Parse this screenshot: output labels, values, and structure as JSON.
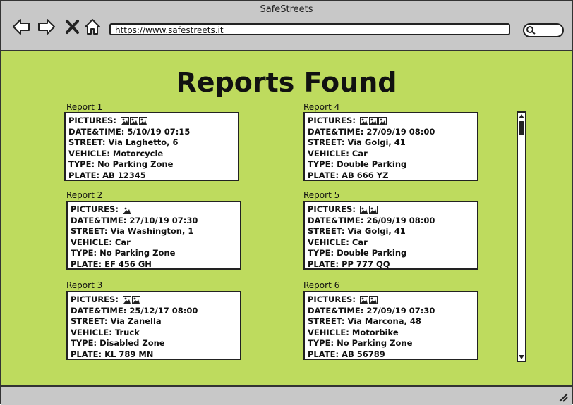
{
  "window": {
    "title": "SafeStreets"
  },
  "toolbar": {
    "url": "https://www.safestreets.it"
  },
  "page": {
    "heading": "Reports Found"
  },
  "field_labels": {
    "pictures": "PICTURES:",
    "datetime": "DATE&TIME:",
    "street": "STREET:",
    "vehicle": "VEHICLE:",
    "type": "TYPE:",
    "plate": "PLATE:"
  },
  "reports": [
    {
      "label": "Report 1",
      "picture_count": 3,
      "datetime": "5/10/19 07:15",
      "street": "Via Laghetto, 6",
      "vehicle": "Motorcycle",
      "type": "No Parking Zone",
      "plate": "AB 12345"
    },
    {
      "label": "Report 2",
      "picture_count": 1,
      "datetime": "27/10/19 07:30",
      "street": "Via Washington, 1",
      "vehicle": "Car",
      "type": "No Parking Zone",
      "plate": "EF 456 GH"
    },
    {
      "label": "Report 3",
      "picture_count": 2,
      "datetime": "25/12/17 08:00",
      "street": "Via Zanella",
      "vehicle": "Truck",
      "type": "Disabled Zone",
      "plate": "KL 789 MN"
    },
    {
      "label": "Report 4",
      "picture_count": 3,
      "datetime": "27/09/19 08:00",
      "street": "Via Golgi, 41",
      "vehicle": "Car",
      "type": "Double Parking",
      "plate": "AB 666 YZ"
    },
    {
      "label": "Report 5",
      "picture_count": 2,
      "datetime": "26/09/19 08:00",
      "street": "Via Golgi, 41",
      "vehicle": "Car",
      "type": "Double Parking",
      "plate": "PP 777 QQ"
    },
    {
      "label": "Report 6",
      "picture_count": 2,
      "datetime": "27/09/19 07:30",
      "street": "Via Marcona, 48",
      "vehicle": "Motorbike",
      "type": "No Parking Zone",
      "plate": "AB 56789"
    }
  ],
  "icons": {
    "back": "arrow-left-icon",
    "forward": "arrow-right-icon",
    "stop": "close-icon",
    "home": "home-icon",
    "search": "search-icon",
    "picture": "image-icon",
    "resize": "resize-grip-icon"
  },
  "colors": {
    "content_background": "#bedb5e",
    "chrome": "#c8c8c8"
  }
}
